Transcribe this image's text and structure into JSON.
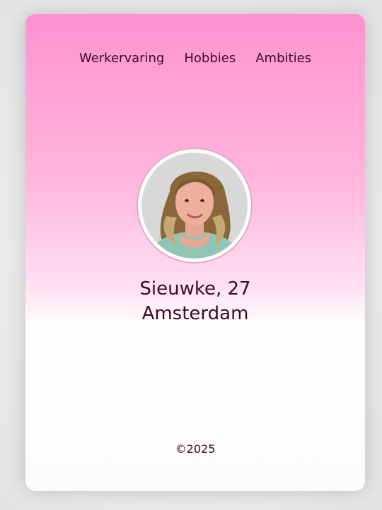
{
  "nav": {
    "items": [
      {
        "label": "Werkervaring"
      },
      {
        "label": "Hobbies"
      },
      {
        "label": "Ambities"
      }
    ]
  },
  "profile": {
    "name_age": "Sieuwke, 27",
    "city": "Amsterdam"
  },
  "footer": {
    "copyright": "©2025"
  },
  "colors": {
    "text": "#3e0a25",
    "gradient_top": "#ff93d0",
    "gradient_bottom": "#fdfcfc"
  }
}
